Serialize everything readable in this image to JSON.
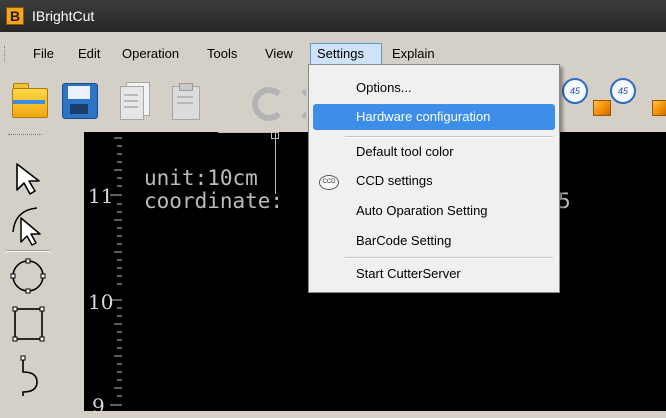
{
  "window": {
    "title": "IBrightCut",
    "app_icon_letter": "B"
  },
  "menubar": {
    "items": [
      {
        "label": "File"
      },
      {
        "label": "Edit"
      },
      {
        "label": "Operation"
      },
      {
        "label": "Tools"
      },
      {
        "label": "View"
      },
      {
        "label": "Settings",
        "active": true
      },
      {
        "label": "Explain"
      }
    ]
  },
  "settings_menu": {
    "items": [
      {
        "label": "Options..."
      },
      {
        "label": "Hardware configuration",
        "highlighted": true
      },
      {
        "label": "Default tool color"
      },
      {
        "label": "CCD settings",
        "icon": "ccd-icon",
        "icon_text": "CCD"
      },
      {
        "label": "Auto Oparation Setting"
      },
      {
        "label": "BarCode Setting"
      },
      {
        "label": "Start CutterServer"
      }
    ]
  },
  "toolbar": {
    "buttons": [
      {
        "icon": "open-folder-icon"
      },
      {
        "icon": "save-icon"
      },
      {
        "icon": "copy-icon"
      },
      {
        "icon": "paste-icon"
      },
      {
        "icon": "undo-icon"
      },
      {
        "icon": "redo-icon"
      },
      {
        "icon": "rotate-45-ccw-icon",
        "label": "45"
      },
      {
        "icon": "rotate-45-cw-icon",
        "label": "45"
      },
      {
        "icon": "box-icon"
      }
    ]
  },
  "tool_panel": {
    "tools": [
      {
        "icon": "select-arrow-icon"
      },
      {
        "icon": "node-edit-arrow-icon"
      },
      {
        "icon": "circle-tool-icon"
      },
      {
        "icon": "rectangle-tool-icon"
      },
      {
        "icon": "pen-tool-icon"
      }
    ]
  },
  "canvas": {
    "ruler_labels": [
      "11",
      "10",
      "9"
    ],
    "unit_text": "unit:10cm",
    "coordinate_text": "coordinate:",
    "coordinate_tail": "5"
  },
  "colors": {
    "titlebar": "#2b2b2b",
    "menu_highlight": "#3d8ee8",
    "canvas_background": "#000000",
    "chrome": "#d4d0c8"
  }
}
